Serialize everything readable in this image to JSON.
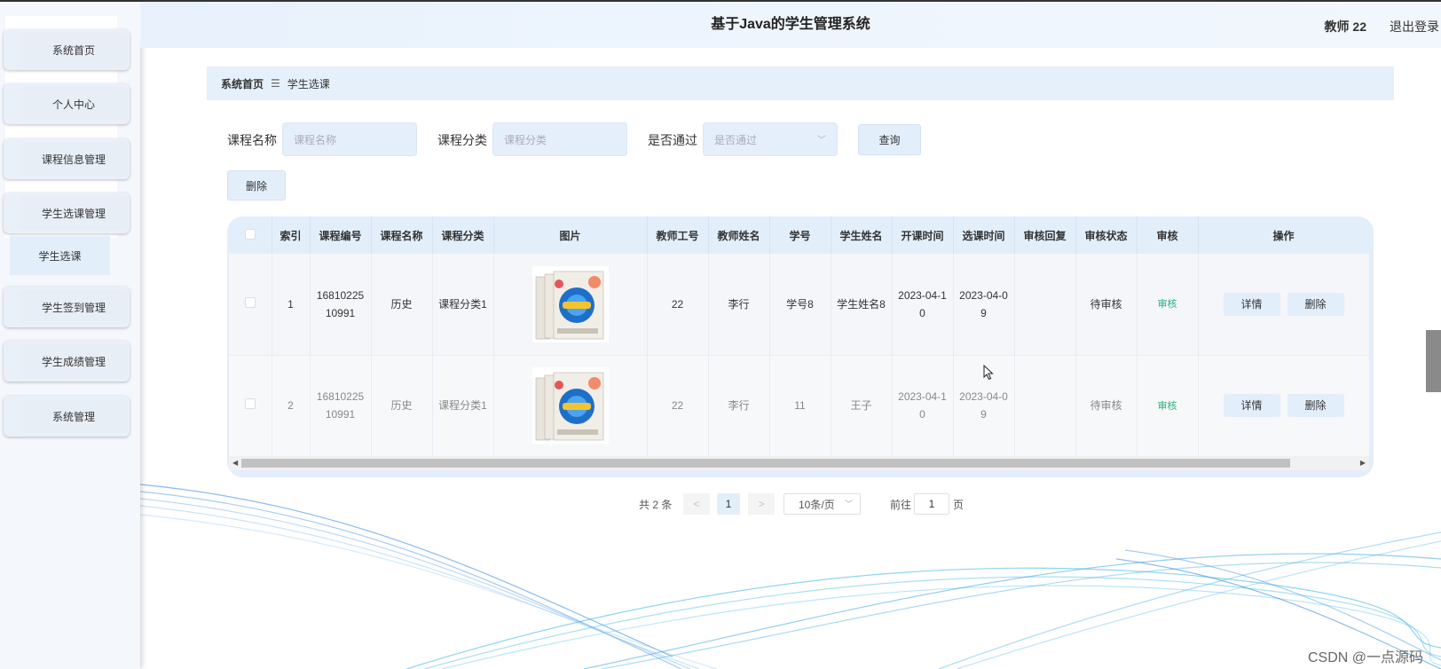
{
  "header": {
    "title": "基于Java的学生管理系统",
    "user": "教师 22",
    "logout": "退出登录"
  },
  "sidebar": {
    "items": [
      {
        "label": "系统首页"
      },
      {
        "label": "个人中心"
      },
      {
        "label": "课程信息管理"
      },
      {
        "label": "学生选课管理"
      },
      {
        "label": "学生签到管理"
      },
      {
        "label": "学生成绩管理"
      },
      {
        "label": "系统管理"
      }
    ],
    "sub_item": "学生选课"
  },
  "breadcrumb": {
    "home": "系统首页",
    "separator": "☰",
    "current": "学生选课"
  },
  "filters": {
    "course_name_label": "课程名称",
    "course_name_placeholder": "课程名称",
    "course_category_label": "课程分类",
    "course_category_placeholder": "课程分类",
    "passed_label": "是否通过",
    "passed_placeholder": "是否通过",
    "search_button": "查询",
    "delete_button": "删除"
  },
  "table": {
    "columns": [
      "索引",
      "课程编号",
      "课程名称",
      "课程分类",
      "图片",
      "教师工号",
      "教师姓名",
      "学号",
      "学生姓名",
      "开课时间",
      "选课时间",
      "审核回复",
      "审核状态",
      "审核",
      "操作"
    ],
    "rows": [
      {
        "index": "1",
        "course_no": "1681022510991",
        "course_name": "历史",
        "category": "课程分类1",
        "teacher_no": "22",
        "teacher_name": "李行",
        "student_no": "学号8",
        "student_name": "学生姓名8",
        "start_time": "2023-04-10",
        "select_time": "2023-04-09",
        "reply": "",
        "status": "待审核",
        "audit": "审核",
        "detail": "详情",
        "delete": "删除"
      },
      {
        "index": "2",
        "course_no": "1681022510991",
        "course_name": "历史",
        "category": "课程分类1",
        "teacher_no": "22",
        "teacher_name": "李行",
        "student_no": "11",
        "student_name": "王子",
        "start_time": "2023-04-10",
        "select_time": "2023-04-09",
        "reply": "",
        "status": "待审核",
        "audit": "审核",
        "detail": "详情",
        "delete": "删除"
      }
    ]
  },
  "pagination": {
    "total": "共 2 条",
    "prev": "<",
    "current_page": "1",
    "next": ">",
    "page_size": "10条/页",
    "goto_label": "前往",
    "goto_value": "1",
    "page_suffix": "页"
  },
  "watermark": "CSDN @一点源码",
  "colors": {
    "accent": "#e3eefb",
    "audit_link": "#2bb07a",
    "sidebar_bg": "#f4f8fd"
  }
}
